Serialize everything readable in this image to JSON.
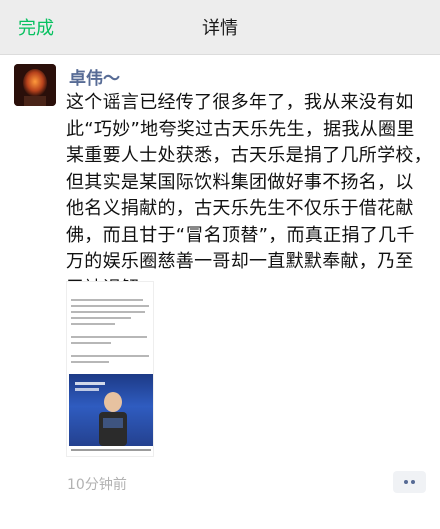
{
  "navbar": {
    "done_label": "完成",
    "title": "详情"
  },
  "post": {
    "author": "卓伟～",
    "text": "这个谣言已经传了很多年了，我从来没有如\n此“巧妙”地夸奖过古天乐先生，据我从圈里\n某重要人士处获悉，古天乐是捐了几所学校，\n但其实是某国际饮料集团做好事不扬名，以\n他名义捐献的，古天乐先生不仅乐于借花献\n佛，而且甘于“冒名顶替”，而真正捐了几千\n万的娱乐圈慈善一哥却一直默默奉献，乃至\n于被误解。",
    "time": "10分钟前"
  },
  "colors": {
    "accent": "#07c160",
    "link": "#576b95",
    "navbar_bg": "#ededed",
    "text": "#111111",
    "muted": "#b2b2b2"
  },
  "icons": {
    "avatar": "avatar-image",
    "more": "more-dots-icon"
  }
}
